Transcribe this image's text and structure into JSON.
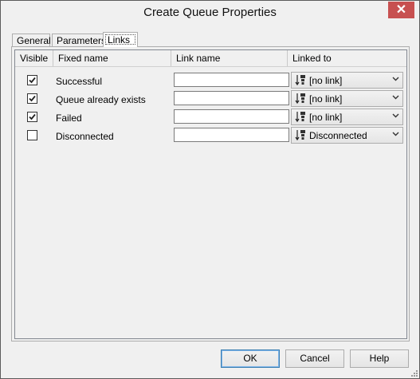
{
  "window": {
    "title": "Create Queue Properties",
    "close_symbol": "✕"
  },
  "tabs": [
    {
      "label": "General",
      "active": false
    },
    {
      "label": "Parameters",
      "active": false
    },
    {
      "label": "Links",
      "active": true
    }
  ],
  "grid": {
    "columns": [
      "Visible",
      "Fixed name",
      "Link name",
      "Linked to"
    ],
    "rows": [
      {
        "visible": true,
        "fixed_name": "Successful",
        "link_name": "",
        "linked_to": "[no link]"
      },
      {
        "visible": true,
        "fixed_name": "Queue already exists",
        "link_name": "",
        "linked_to": "[no link]"
      },
      {
        "visible": true,
        "fixed_name": "Failed",
        "link_name": "",
        "linked_to": "[no link]"
      },
      {
        "visible": false,
        "fixed_name": "Disconnected",
        "link_name": "",
        "linked_to": "Disconnected"
      }
    ]
  },
  "buttons": {
    "ok": "OK",
    "cancel": "Cancel",
    "help": "Help"
  },
  "colors": {
    "close_button": "#c75050",
    "default_button_border": "#3c7fb1"
  }
}
